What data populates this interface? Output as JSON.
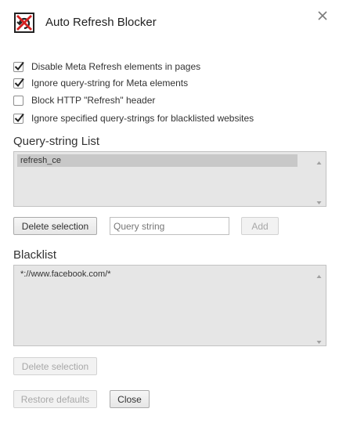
{
  "header": {
    "app_title": "Auto Refresh Blocker",
    "app_icon": "no-refresh-icon",
    "close_icon": "close-icon"
  },
  "options": [
    {
      "label": "Disable Meta Refresh elements in pages",
      "checked": true
    },
    {
      "label": "Ignore query-string for Meta elements",
      "checked": true
    },
    {
      "label": "Block HTTP \"Refresh\" header",
      "checked": false
    },
    {
      "label": "Ignore specified query-strings for blacklisted websites",
      "checked": true
    }
  ],
  "query_string_list": {
    "heading": "Query-string List",
    "items": [
      {
        "text": "refresh_ce",
        "selected": true
      }
    ],
    "delete_label": "Delete selection",
    "input_placeholder": "Query string",
    "input_value": "",
    "add_label": "Add"
  },
  "blacklist": {
    "heading": "Blacklist",
    "items": [
      {
        "text": "*://www.facebook.com/*",
        "selected": false
      }
    ],
    "delete_label": "Delete selection"
  },
  "footer": {
    "restore_label": "Restore defaults",
    "close_label": "Close"
  },
  "colors": {
    "list_background": "#e6e6e6",
    "selected_item": "#c8c8c8",
    "icon_red": "#d42020"
  }
}
